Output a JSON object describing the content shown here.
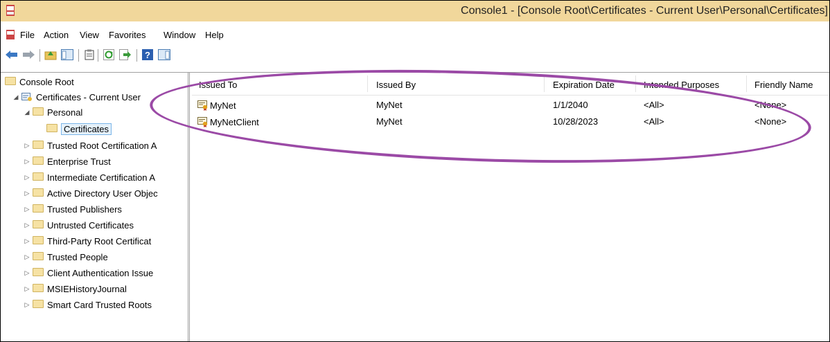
{
  "window": {
    "title": "Console1 - [Console Root\\Certificates - Current User\\Personal\\Certificates]"
  },
  "menu": {
    "items": [
      "File",
      "Action",
      "View",
      "Favorites",
      "Window",
      "Help"
    ]
  },
  "toolbar": {
    "icons": [
      "back-arrow-icon",
      "forward-arrow-icon",
      "up-folder-icon",
      "show-hide-tree-icon",
      "clipboard-icon",
      "refresh-icon",
      "export-list-icon",
      "help-icon",
      "show-action-pane-icon"
    ]
  },
  "tree": {
    "root": "Console Root",
    "store": "Certificates - Current User",
    "personal": "Personal",
    "certificates": "Certificates",
    "folders": [
      "Trusted Root Certification A",
      "Enterprise Trust",
      "Intermediate Certification A",
      "Active Directory User Objec",
      "Trusted Publishers",
      "Untrusted Certificates",
      "Third-Party Root Certificat",
      "Trusted People",
      "Client Authentication Issue",
      "MSIEHistoryJournal",
      "Smart Card Trusted Roots"
    ]
  },
  "list": {
    "columns": [
      "Issued To",
      "Issued By",
      "Expiration Date",
      "Intended Purposes",
      "Friendly Name"
    ],
    "rows": [
      [
        "MyNet",
        "MyNet",
        "1/1/2040",
        "<All>",
        "<None>"
      ],
      [
        "MyNetClient",
        "MyNet",
        "10/28/2023",
        "<All>",
        "<None>"
      ]
    ]
  },
  "colors": {
    "titlebar": "#f1d79b",
    "highlight_oval": "#9b4aa6",
    "selection": "#e5f1fb"
  }
}
